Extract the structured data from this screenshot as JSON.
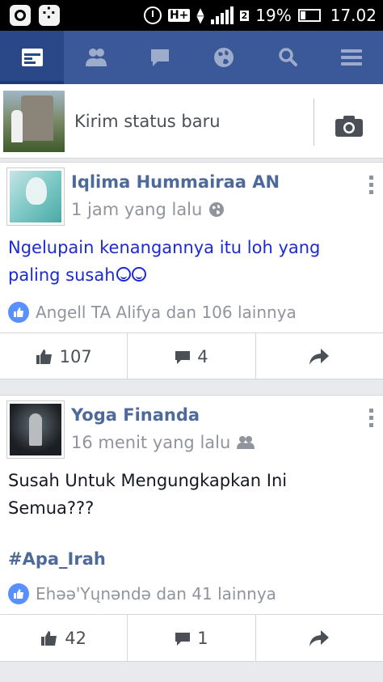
{
  "status_bar": {
    "network_type": "H+",
    "sim": "2",
    "battery_percent": "19%",
    "time": "17.02"
  },
  "nav": {
    "items": [
      {
        "icon": "news-feed-icon",
        "active": true
      },
      {
        "icon": "friends-icon",
        "active": false
      },
      {
        "icon": "messages-icon",
        "active": false
      },
      {
        "icon": "notifications-globe-icon",
        "active": false
      },
      {
        "icon": "search-icon",
        "active": false
      },
      {
        "icon": "menu-icon",
        "active": false
      }
    ],
    "accent": "#3b5998"
  },
  "composer": {
    "placeholder": "Kirim status baru",
    "camera_icon": "camera-icon"
  },
  "posts": [
    {
      "author": "Iqlima Hummairaa AN",
      "time": "1 jam yang lalu",
      "privacy_icon": "globe-icon",
      "text": "Ngelupain kenangannya itu loh yang paling susah",
      "likes_summary": "Angell TA Alifya dan 106 lainnya",
      "like_count": "107",
      "comment_count": "4"
    },
    {
      "author": "Yoga Finanda",
      "time": "16 menit yang lalu",
      "privacy_icon": "friends-icon",
      "text_line1": "Susah Untuk Mengungkapkan Ini",
      "text_line2": "Semua???",
      "hashtag": "#Apa_Irah",
      "likes_summary": "Ehəə'Yųnəndə dan 41 lainnya",
      "like_count": "42",
      "comment_count": "1"
    }
  ]
}
